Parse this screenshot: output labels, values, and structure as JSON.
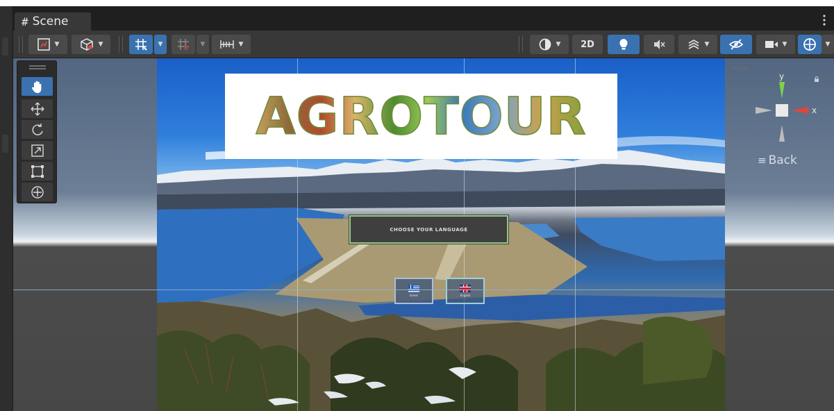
{
  "tab": {
    "title": "Scene",
    "icon": "hash-icon"
  },
  "toolbar": {
    "mode_2d_label": "2D",
    "icons": [
      "draw-mode-icon",
      "render-mode-icon",
      "grid-snap-icon",
      "increment-snap-icon",
      "ruler-icon",
      "shading-icon",
      "lighting-icon",
      "audio-icon",
      "effects-icon",
      "hidden-objects-icon",
      "camera-icon",
      "gizmos-icon"
    ]
  },
  "tools": [
    "hand-tool",
    "move-tool",
    "rotate-tool",
    "scale-tool",
    "rect-tool",
    "transform-tool"
  ],
  "canvas": {
    "logo": "AGROTOUR",
    "choose_language": "CHOOSE YOUR LANGUAGE",
    "greek_caption": "Greek",
    "english_caption": "English"
  },
  "gizmo": {
    "y_label": "y",
    "x_label": "x",
    "back_label": "Back",
    "colors": {
      "y_axis": "#7ed348",
      "x_axis": "#e0463a",
      "neutral": "#bdbdbd"
    }
  },
  "colors": {
    "accent": "#3a72b0",
    "panel": "#383838",
    "tab_bar": "#1f1f1f"
  }
}
